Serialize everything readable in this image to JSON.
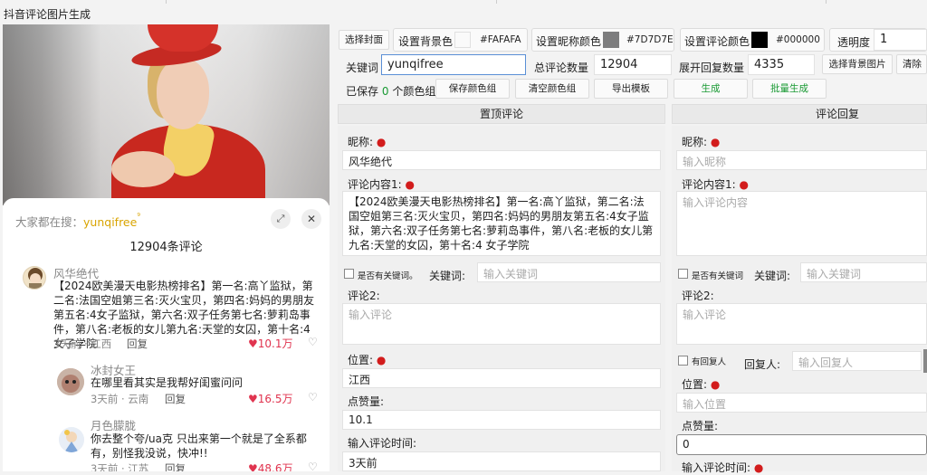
{
  "window": {
    "title": "抖音评论图片生成"
  },
  "preview": {
    "hot_search_label": "大家都在搜：",
    "hot_search_keyword": "yunqifree",
    "search_glyph": "⁹",
    "expand_glyph": "⤢",
    "close_glyph": "✕",
    "count_title": "12904条评论",
    "comments": [
      {
        "name": "风华绝代",
        "text": "【2024欧美漫天电影热榜排名】第一名:高丫监狱，第二名:法国空姐第三名:灭火宝贝，第四名:妈妈的男朋友第五名:4女子监狱，第六名:双子任务第七名:萝莉岛事件，第八名:老板的女儿第九名:天堂的女囚，第十名:4 女子学院",
        "meta": "3天前 · 江西",
        "reply": "回复",
        "likes": "♥10.1万",
        "dislike": "♡"
      },
      {
        "name": "冰封女王",
        "text": "在哪里看其实是我帮好闺蜜问问",
        "meta": "3天前 · 云南",
        "reply": "回复",
        "likes": "♥16.5万",
        "dislike": "♡"
      },
      {
        "name": "月色朦胧",
        "text": "你去整个夸/ua克 只出来第一个就是了全系都有，别怪我没说，快冲!!",
        "meta": "3天前 · 江苏",
        "reply": "回复",
        "likes": "♥48.6万",
        "dislike": "♡"
      }
    ]
  },
  "toolbar": {
    "choose_cover": "选择封面",
    "set_bg_color": "设置背景色",
    "bg_color_value": "#FAFAFA",
    "set_nick_color": "设置昵称颜色",
    "nick_color_value": "#7D7D7E",
    "set_comment_color": "设置评论颜色",
    "comment_color_value": "#000000",
    "opacity_label": "透明度",
    "opacity_value": "1",
    "keyword_label": "关键词",
    "keyword_value": "yunqifree",
    "total_label": "总评论数量",
    "total_value": "12904",
    "expand_label": "展开回复数量",
    "expand_value": "4335",
    "choose_bg_image": "选择背景图片",
    "clear_bg": "清除背",
    "saved_prefix": "已保存",
    "saved_count": "0",
    "saved_suffix": "个颜色组",
    "save_color_group": "保存颜色组",
    "clear_color_group": "清空颜色组",
    "export_template": "导出模板",
    "generate": "生成",
    "batch_generate": "批量生成"
  },
  "colors": {
    "bg": "#FAFAFA",
    "nick": "#7D7D7E",
    "comment": "#000000",
    "green": "#1a9a34",
    "required": "#d21c1c"
  },
  "left_form": {
    "header": "置顶评论",
    "nick_label": "昵称:",
    "nick_value": "风华绝代",
    "content_label": "评论内容1:",
    "content_value": "【2024欧美漫天电影热榜排名】第一名:高丫监狱，第二名:法国空姐第三名:灭火宝贝，第四名:妈妈的男朋友第五名:4女子监狱，第六名:双子任务第七名:萝莉岛事件，第八名:老板的女儿第九名:天堂的女囚，第十名:4 女子学院",
    "has_keyword_label": "是否有关键词。",
    "keyword_label": "关键词:",
    "keyword_placeholder": "输入关键词",
    "comment2_label": "评论2:",
    "comment2_placeholder": "输入评论",
    "location_label": "位置:",
    "location_value": "江西",
    "likes_label": "点赞量:",
    "likes_value": "10.1",
    "time_label": "输入评论时间:",
    "time_value": "3天前"
  },
  "right_form": {
    "header": "评论回复",
    "nick_label": "昵称:",
    "nick_placeholder": "输入昵称",
    "content_label": "评论内容1:",
    "content_placeholder": "输入评论内容",
    "has_keyword_label": "是否有关键词",
    "keyword_label": "关键词:",
    "keyword_placeholder": "输入关键词",
    "comment2_label": "评论2:",
    "comment2_placeholder": "输入评论",
    "has_reply_label": "有回复人",
    "replier_label": "回复人:",
    "replier_placeholder": "输入回复人",
    "location_label": "位置:",
    "location_placeholder": "输入位置",
    "likes_label": "点赞量:",
    "likes_value": "0",
    "time_label": "输入评论时间:"
  }
}
